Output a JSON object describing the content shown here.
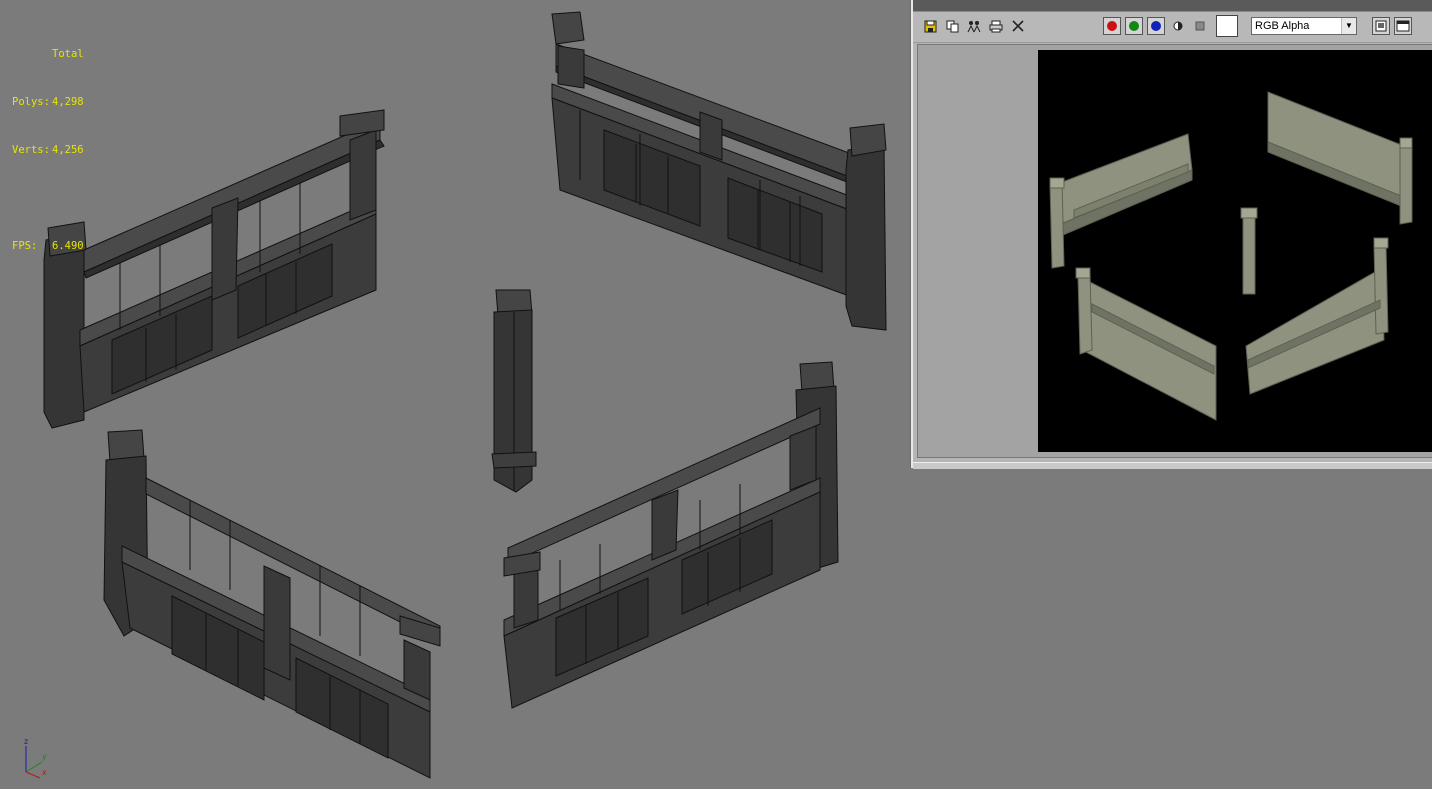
{
  "viewport": {
    "stats": {
      "header": "Total",
      "polys_label": "Polys:",
      "polys_value": "4,298",
      "verts_label": "Verts:",
      "verts_value": "4,256",
      "fps_label": "FPS:",
      "fps_value": "6.490"
    },
    "axis": {
      "z": "z",
      "y": "y",
      "x": "x"
    },
    "colors": {
      "background": "#7b7b7b",
      "stats_text": "#e6e600"
    }
  },
  "frame_buffer": {
    "toolbar": {
      "icons": [
        "save-icon",
        "copy-icon",
        "clone-icon",
        "print-icon",
        "clear-icon"
      ],
      "channel_buttons": [
        {
          "name": "red-channel",
          "color": "#cc1111"
        },
        {
          "name": "green-channel",
          "color": "#118811"
        },
        {
          "name": "blue-channel",
          "color": "#1122bb"
        }
      ],
      "mono_icon": "half-circle-icon",
      "alpha_icon": "square-icon",
      "swatch_color": "#ffffff",
      "channel_select": "RGB Alpha",
      "right_icons": [
        "display-icon",
        "window-icon"
      ]
    }
  }
}
